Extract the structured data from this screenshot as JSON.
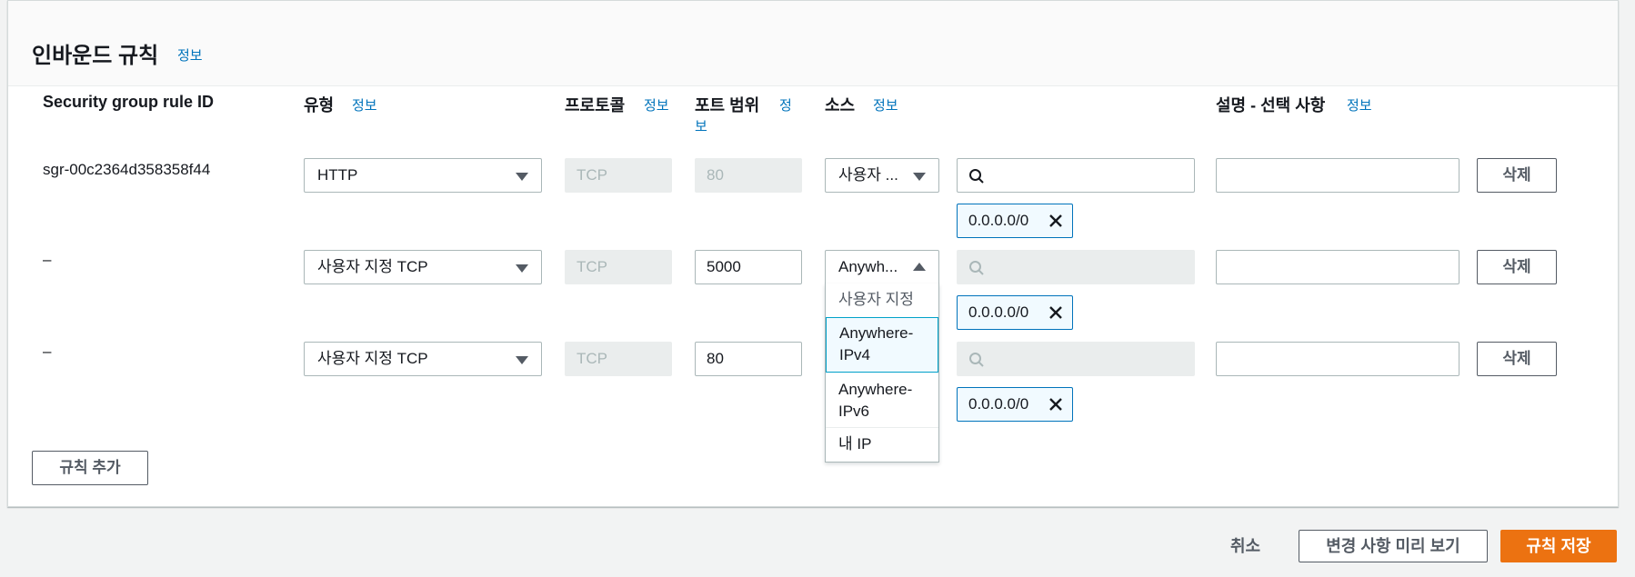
{
  "panel": {
    "title": "인바운드 규칙",
    "info": "정보"
  },
  "columns": {
    "rule_id": "Security group rule ID",
    "type": "유형",
    "type_info": "정보",
    "protocol": "프로토콜",
    "protocol_info": "정보",
    "port_range": "포트 범위",
    "port_info_1": "정",
    "port_info_2": "보",
    "source": "소스",
    "source_info": "정보",
    "description": "설명 - 선택 사항",
    "description_info": "정보"
  },
  "rows": [
    {
      "rule_id": "sgr-00c2364d358358f44",
      "type": "HTTP",
      "protocol": "TCP",
      "port": "80",
      "source_type": "사용자 ...",
      "source_search": "",
      "token": "0.0.0.0/0",
      "description": "",
      "delete": "삭제"
    },
    {
      "rule_id": "–",
      "type": "사용자 지정 TCP",
      "protocol": "TCP",
      "port": "5000",
      "source_type": "Anywh...",
      "source_search": "",
      "token": "0.0.0.0/0",
      "description": "",
      "delete": "삭제"
    },
    {
      "rule_id": "–",
      "type": "사용자 지정 TCP",
      "protocol": "TCP",
      "port": "80",
      "source_type": "",
      "source_search": "",
      "token": "0.0.0.0/0",
      "description": "",
      "delete": "삭제"
    }
  ],
  "source_dropdown": {
    "options": [
      {
        "line1": "사용자 지정",
        "line2": ""
      },
      {
        "line1": "Anywhere-",
        "line2": "IPv4"
      },
      {
        "line1": "Anywhere-",
        "line2": "IPv6"
      },
      {
        "line1": "내 IP",
        "line2": ""
      }
    ],
    "selected_index": 1
  },
  "add_rule": "규칙 추가",
  "footer": {
    "cancel": "취소",
    "preview": "변경 사항 미리 보기",
    "save": "규칙 저장"
  },
  "icons": {
    "search": "search-icon",
    "remove": "close-icon",
    "caret": "caret-down-icon"
  },
  "colors": {
    "accent": "#ec7211",
    "link": "#0073bb",
    "token_border": "#0073bb",
    "token_bg": "#f1faff"
  }
}
